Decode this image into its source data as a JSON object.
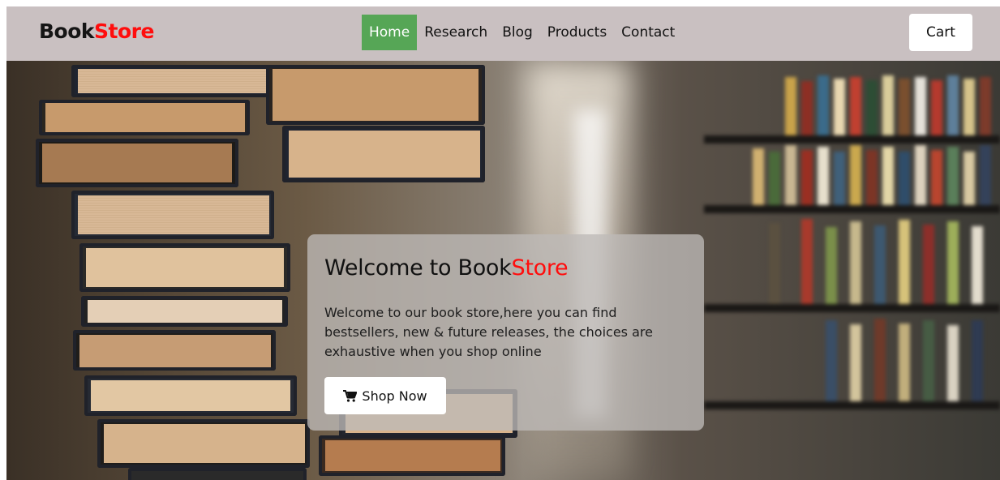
{
  "brand": {
    "part1": "Book",
    "part2": "Store"
  },
  "nav": {
    "items": [
      {
        "label": "Home"
      },
      {
        "label": "Research"
      },
      {
        "label": "Blog"
      },
      {
        "label": "Products"
      },
      {
        "label": "Contact"
      }
    ],
    "active": "Home"
  },
  "cart": {
    "label": "Cart"
  },
  "hero": {
    "title_part1": "Welcome to Book",
    "title_part2": "Store",
    "description": "Welcome to our book store,here you can find bestsellers, new & future releases, the choices are exhaustive when you shop online",
    "button_label": "Shop Now",
    "button_icon": "shopping-cart-icon"
  },
  "colors": {
    "navbar_bg": "#c9c0c1",
    "brand_accent": "#ff0d0d",
    "active_nav_bg": "#56a656"
  }
}
